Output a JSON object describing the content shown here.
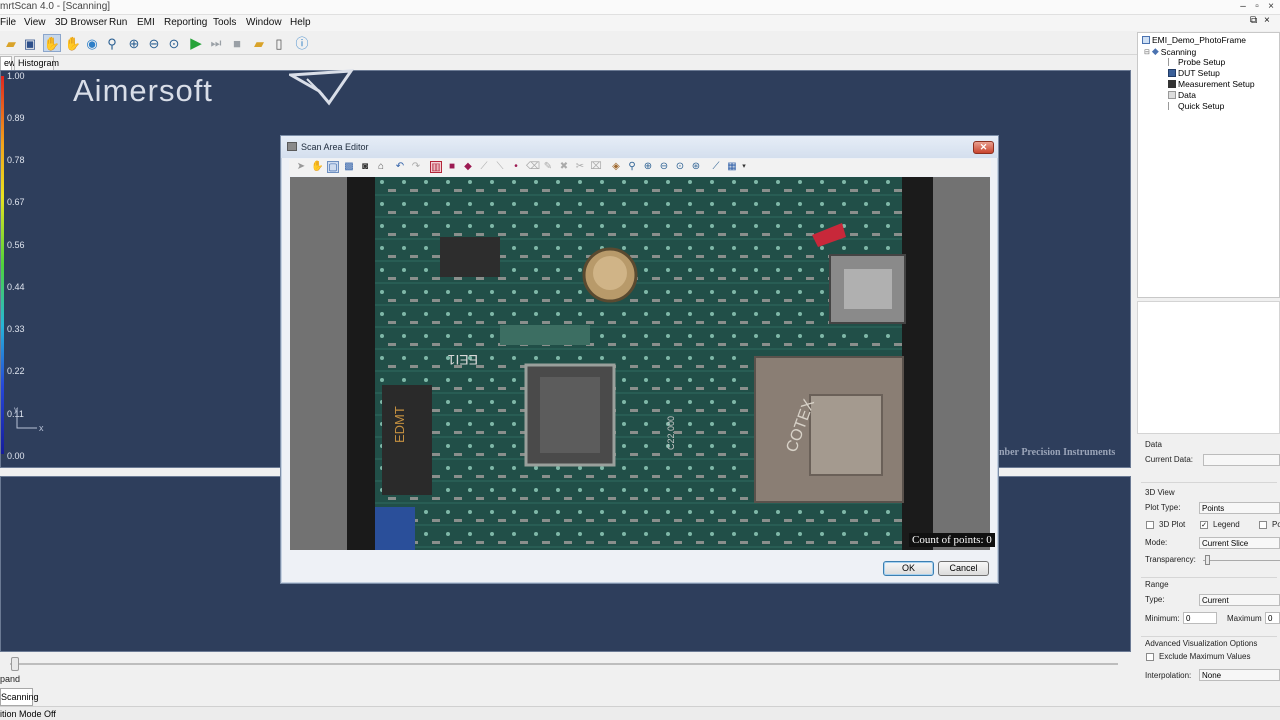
{
  "window": {
    "title": "mrtScan 4.0 - [Scanning]"
  },
  "menu": [
    "File",
    "View",
    "3D Browser",
    "Run",
    "EMI",
    "Reporting",
    "Tools",
    "Window",
    "Help"
  ],
  "view_tabs": [
    "ew",
    "Histogram"
  ],
  "colorbar": {
    "labels": [
      "1.00",
      "0.89",
      "0.78",
      "0.67",
      "0.56",
      "0.44",
      "0.33",
      "0.22",
      "0.11",
      "0.00"
    ],
    "gradient": [
      "#e0261f",
      "#f2a41c",
      "#e8e321",
      "#4fd33c",
      "#26b6d9",
      "#2647d9",
      "#151c9a"
    ]
  },
  "view": {
    "watermark": "Aimersoft",
    "footer_text": "nber Precision Instruments",
    "axis_x": "x",
    "axis_y": "y"
  },
  "tree": {
    "root": "EMI_Demo_PhotoFrame",
    "group": "Scanning",
    "items": [
      "Probe Setup",
      "DUT Setup",
      "Measurement Setup",
      "Data",
      "Quick Setup"
    ]
  },
  "props": {
    "data_header": "Data",
    "current_data_label": "Current Data:",
    "current_data_value": "",
    "view3d_header": "3D View",
    "plot_type_label": "Plot Type:",
    "plot_type_value": "Points",
    "plot3d_label": "3D Plot",
    "plot3d_checked": false,
    "legend_label": "Legend",
    "legend_checked": true,
    "po_label": "Po",
    "mode_label": "Mode:",
    "mode_value": "Current Slice",
    "transparency_label": "Transparency:",
    "range_header": "Range",
    "type_label": "Type:",
    "type_value": "Current",
    "minimum_label": "Minimum:",
    "minimum_value": "0",
    "maximum_label": "Maximum",
    "maximum_value": "0",
    "adv_header": "Advanced Visualization Options",
    "exclude_label": "Exclude Maximum Values",
    "interp_label": "Interpolation:",
    "interp_value": "None"
  },
  "dialog": {
    "title": "Scan Area Editor",
    "count_label": "Count of points: 0",
    "ok": "OK",
    "cancel": "Cancel",
    "pcb_marks": [
      "EEI1",
      "EDMT",
      "COTEX",
      "C22.000"
    ]
  },
  "bottom": {
    "expand_label": "pand",
    "scanning_tab": "Scanning",
    "status": "ition Mode Off"
  },
  "accent": {
    "view_bg": "#2e3e5c",
    "tree_icon": "#4a72b0"
  }
}
